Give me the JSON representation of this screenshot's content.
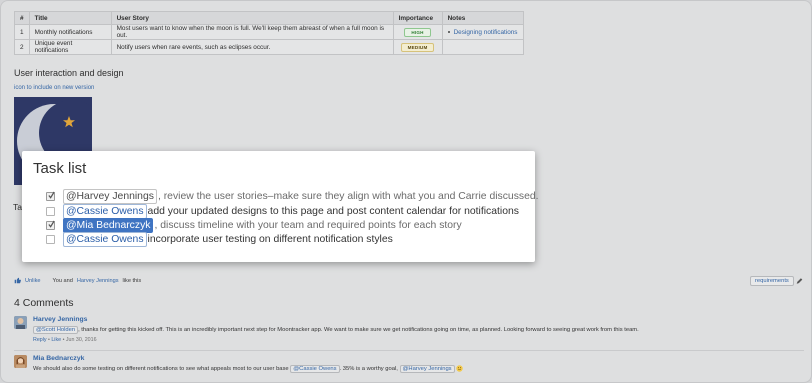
{
  "requirements_table": {
    "headers": [
      "#",
      "Title",
      "User Story",
      "Importance",
      "Notes"
    ],
    "rows": [
      {
        "num": "1",
        "title": "Monthly notifications",
        "story": "Most users want to know when the moon is full. We'll keep them abreast of when a full moon is out.",
        "importance": "HIGH",
        "notes": "Designing notifications"
      },
      {
        "num": "2",
        "title": "Unique event notifications",
        "story": "Notify users when rare events, such as eclipses occur.",
        "importance": "MEDIUM",
        "notes": ""
      }
    ]
  },
  "design_section": {
    "heading": "User interaction and design",
    "link": "icon to include on new version",
    "fragment": "Ta"
  },
  "task_list": {
    "title": "Task list",
    "items": [
      {
        "checked": true,
        "mention": "@Harvey Jennings",
        "text": ", review the user stories–make sure they align with what you and Carrie discussed."
      },
      {
        "checked": false,
        "mention": "@Cassie Owens",
        "text": " add your updated designs to this page and post content calendar for notifications"
      },
      {
        "checked": true,
        "mention": "@Mia Bednarczyk",
        "text": ", discuss timeline with your team and required points for each story"
      },
      {
        "checked": false,
        "mention": "@Cassie Owens",
        "text": " incorporate user testing on different notification styles"
      }
    ]
  },
  "likes": {
    "unlike_label": "Unlike",
    "text_prefix": "You and",
    "person": "Harvey Jennings",
    "text_suffix": "like this"
  },
  "label": "requirements",
  "comments": {
    "heading": "4 Comments",
    "items": [
      {
        "author": "Harvey Jennings",
        "mention": "@Scott Holden",
        "text": ", thanks for getting this kicked off. This is an incredibly important next step for Moontracker app. We want to make sure we get notifications going on time, as planned. Looking forward to seeing great work from this team.",
        "reply": "Reply",
        "like": "Like",
        "date": "Jun 30, 2016"
      },
      {
        "author": "Mia Bednarczyk",
        "text_before": "We should also do some testing on different notifications to see what appeals most to our user base",
        "mention1": "@Cassie Owens",
        "text_middle": ". 35% is a worthy goal,",
        "mention2": "@Harvey Jennings"
      }
    ]
  },
  "colors": {
    "link": "#3566a5",
    "mention_highlight": "#3f74c2",
    "moon_bg": "#2e3866"
  }
}
